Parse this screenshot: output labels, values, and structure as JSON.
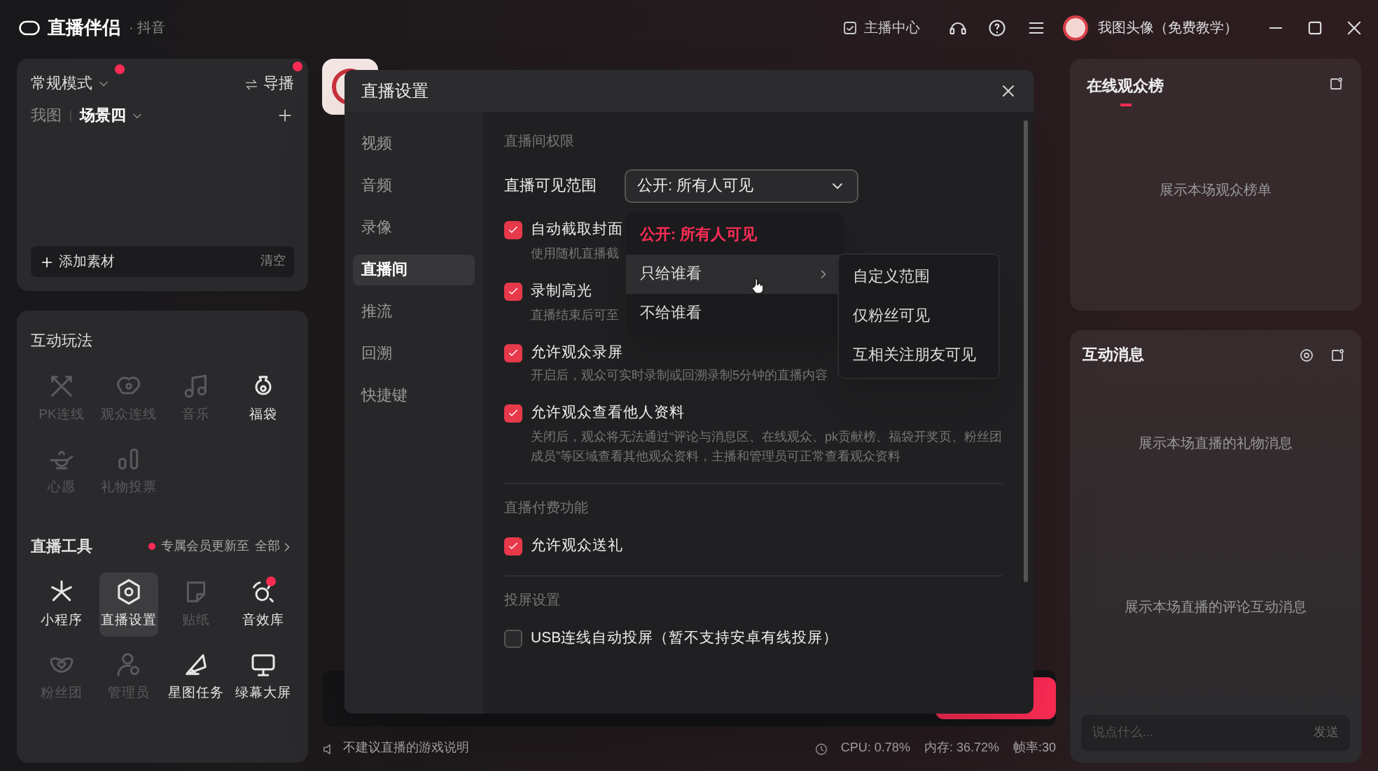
{
  "app_bar": {
    "title": "直播伴侣",
    "platform": "· 抖音",
    "anchor_center": "主播中心",
    "user_name": "我图头像（免费教学）"
  },
  "scene_panel": {
    "mode": "常规模式",
    "mode_badge": true,
    "director": "导播",
    "director_badge": true,
    "scenes": [
      {
        "label": "我图",
        "selected": false
      },
      {
        "label": "场景四",
        "selected": true
      }
    ],
    "add_material": "添加素材",
    "clear": "清空"
  },
  "interactive": {
    "title": "互动玩法",
    "items": [
      {
        "label": "PK连线",
        "kind": "pk",
        "disabled": true,
        "selected": false,
        "badge": false
      },
      {
        "label": "观众连线",
        "kind": "link",
        "disabled": true,
        "selected": false,
        "badge": false
      },
      {
        "label": "音乐",
        "kind": "music",
        "disabled": true,
        "selected": false,
        "badge": false
      },
      {
        "label": "福袋",
        "kind": "bag",
        "disabled": false,
        "selected": false,
        "badge": false
      },
      {
        "label": "心愿",
        "kind": "wish",
        "disabled": true,
        "selected": false,
        "badge": false
      },
      {
        "label": "礼物投票",
        "kind": "vote",
        "disabled": true,
        "selected": false,
        "badge": false
      }
    ]
  },
  "tools": {
    "title": "直播工具",
    "notice": "专属会员更新至",
    "more": "全部",
    "items": [
      {
        "label": "小程序",
        "kind": "miniapp",
        "disabled": false,
        "selected": false,
        "badge": false
      },
      {
        "label": "直播设置",
        "kind": "settings",
        "disabled": false,
        "selected": true,
        "badge": false
      },
      {
        "label": "贴纸",
        "kind": "sticker",
        "disabled": true,
        "selected": false,
        "badge": false
      },
      {
        "label": "音效库",
        "kind": "sound",
        "disabled": false,
        "selected": false,
        "badge": true
      },
      {
        "label": "粉丝团",
        "kind": "fans",
        "disabled": true,
        "selected": false,
        "badge": false
      },
      {
        "label": "管理员",
        "kind": "admin",
        "disabled": true,
        "selected": false,
        "badge": false
      },
      {
        "label": "星图任务",
        "kind": "task",
        "disabled": false,
        "selected": false,
        "badge": false
      },
      {
        "label": "绿幕大屏",
        "kind": "screen",
        "disabled": false,
        "selected": false,
        "badge": false
      }
    ]
  },
  "settings_dialog": {
    "title": "直播设置",
    "nav": [
      {
        "label": "视频",
        "selected": false
      },
      {
        "label": "音频",
        "selected": false
      },
      {
        "label": "录像",
        "selected": false
      },
      {
        "label": "直播间",
        "selected": true
      },
      {
        "label": "推流",
        "selected": false
      },
      {
        "label": "回溯",
        "selected": false
      },
      {
        "label": "快捷键",
        "selected": false
      }
    ],
    "sections": [
      {
        "title": "直播间权限",
        "visibility": {
          "label": "直播可见范围",
          "value": "公开: 所有人可见"
        },
        "options": [
          {
            "label": "自动截取封面",
            "description": "使用随机直播截",
            "checked": true
          },
          {
            "label": "录制高光",
            "description": "直播结束后可至",
            "checked": true
          },
          {
            "label": "允许观众录屏",
            "description": "开启后，观众可实时录制或回溯录制5分钟的直播内容",
            "checked": true
          },
          {
            "label": "允许观众查看他人资料",
            "description": "关闭后，观众将无法通过“评论与消息区、在线观众、pk贡献榜、福袋开奖页、粉丝团成员”等区域查看其他观众资料，主播和管理员可正常查看观众资料",
            "checked": true
          }
        ]
      },
      {
        "title": "直播付费功能",
        "options": [
          {
            "label": "允许观众送礼",
            "checked": true
          }
        ]
      },
      {
        "title": "投屏设置",
        "options": [
          {
            "label": "USB连线自动投屏（暂不支持安卓有线投屏）",
            "checked": false
          }
        ]
      }
    ],
    "visibility_menu": {
      "items": [
        {
          "label": "公开: 所有人可见",
          "selected": true,
          "highlighted": false,
          "submenu": false
        },
        {
          "label": "只给谁看",
          "selected": false,
          "highlighted": true,
          "submenu": true
        },
        {
          "label": "不给谁看",
          "selected": false,
          "highlighted": false,
          "submenu": false
        }
      ],
      "submenu_items": [
        {
          "label": "自定义范围"
        },
        {
          "label": "仅粉丝可见"
        },
        {
          "label": "互相关注朋友可见"
        }
      ]
    }
  },
  "audience_panel": {
    "title": "在线观众榜",
    "empty_text": "展示本场观众榜单"
  },
  "messages_panel": {
    "title": "互动消息",
    "gift_empty": "展示本场直播的礼物消息",
    "comment_empty": "展示本场直播的评论互动消息",
    "input_placeholder": "说点什么...",
    "send": "发送"
  },
  "status_bar": {
    "notice": "不建议直播的游戏说明",
    "cpu": "CPU: 0.78%",
    "memory": "内存: 36.72%",
    "fps": "帧率:30"
  }
}
